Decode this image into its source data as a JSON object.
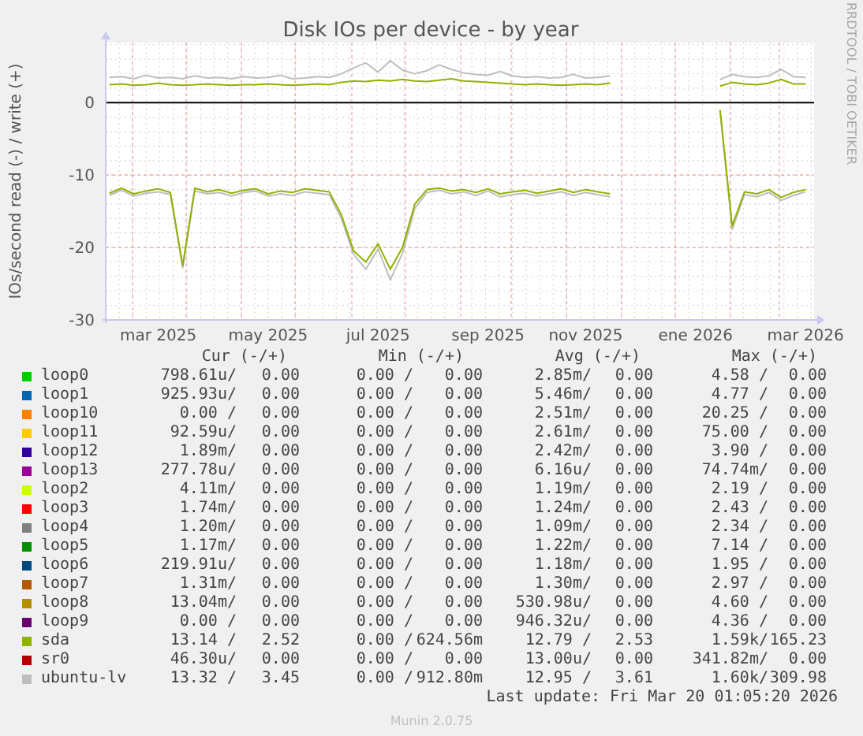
{
  "chart_data": {
    "type": "line",
    "title": "Disk IOs per device - by year",
    "ylabel": "IOs/second read (-) / write (+)",
    "categories": [
      null,
      null,
      null,
      null,
      "mar 2025",
      null,
      null,
      null,
      null,
      null,
      null,
      null,
      null,
      "may 2025",
      null,
      null,
      null,
      null,
      null,
      null,
      null,
      null,
      "jul 2025",
      null,
      null,
      null,
      null,
      null,
      null,
      null,
      null,
      "sep 2025",
      null,
      null,
      null,
      null,
      null,
      null,
      null,
      "nov 2025",
      null,
      null,
      null,
      null,
      null,
      null,
      null,
      null,
      "ene 2026",
      null,
      null,
      null,
      null,
      null,
      null,
      null,
      null,
      "mar 2026"
    ],
    "ylim": [
      -30,
      8.3
    ],
    "grid": true,
    "yticks": [
      0,
      -10,
      -20,
      -30
    ],
    "series": [
      {
        "color": "#bebebe",
        "values": [
          3.5,
          3.6,
          3.3,
          3.8,
          3.4,
          3.5,
          3.3,
          3.7,
          3.4,
          3.5,
          3.3,
          3.6,
          3.4,
          3.5,
          3.8,
          3.3,
          3.4,
          3.6,
          3.5,
          4.0,
          4.8,
          5.5,
          4.2,
          5.8,
          4.5,
          4.0,
          4.4,
          5.2,
          4.6,
          4.1,
          3.9,
          3.8,
          4.3,
          3.7,
          3.5,
          3.6,
          3.4,
          3.5,
          3.9,
          3.4,
          3.5,
          3.7,
          null,
          null,
          null,
          null,
          null,
          null,
          null,
          null,
          3.2,
          3.9,
          3.6,
          3.5,
          3.7,
          4.6,
          3.6,
          3.5
        ]
      },
      {
        "color": "#8fb300",
        "values": [
          2.5,
          2.6,
          2.4,
          2.5,
          2.7,
          2.5,
          2.4,
          2.5,
          2.6,
          2.5,
          2.4,
          2.5,
          2.5,
          2.6,
          2.5,
          2.4,
          2.5,
          2.6,
          2.5,
          2.8,
          3.0,
          2.9,
          3.1,
          3.0,
          3.2,
          3.0,
          2.9,
          3.1,
          3.3,
          3.0,
          2.9,
          2.8,
          2.7,
          2.6,
          2.5,
          2.6,
          2.5,
          2.4,
          2.5,
          2.6,
          2.5,
          2.7,
          null,
          null,
          null,
          null,
          null,
          null,
          null,
          null,
          2.3,
          2.8,
          2.6,
          2.5,
          2.7,
          3.2,
          2.6,
          2.6
        ]
      },
      {
        "color": "#bebebe",
        "values": [
          -12.8,
          -12.1,
          -12.9,
          -12.5,
          -12.3,
          -12.7,
          -22.8,
          -12.2,
          -12.6,
          -12.4,
          -12.9,
          -12.4,
          -12.2,
          -12.9,
          -12.6,
          -12.8,
          -12.3,
          -12.5,
          -12.7,
          -16.0,
          -21.0,
          -23.0,
          -20.2,
          -24.5,
          -20.8,
          -14.6,
          -12.4,
          -12.1,
          -12.6,
          -12.3,
          -12.8,
          -12.2,
          -13.0,
          -12.7,
          -12.5,
          -12.9,
          -12.6,
          -12.3,
          -12.8,
          -12.4,
          -12.7,
          -13.0,
          null,
          null,
          null,
          null,
          null,
          null,
          null,
          null,
          -1.2,
          -17.5,
          -12.7,
          -13.0,
          -12.4,
          -13.5,
          -12.8,
          -12.3
        ]
      },
      {
        "color": "#8fb300",
        "values": [
          -12.5,
          -11.8,
          -12.6,
          -12.2,
          -11.9,
          -12.4,
          -22.5,
          -11.8,
          -12.3,
          -12.0,
          -12.5,
          -12.1,
          -11.9,
          -12.6,
          -12.2,
          -12.4,
          -11.9,
          -12.1,
          -12.3,
          -15.5,
          -20.5,
          -22.0,
          -19.5,
          -23.0,
          -20.0,
          -14.0,
          -12.0,
          -11.8,
          -12.2,
          -12.0,
          -12.4,
          -11.9,
          -12.6,
          -12.3,
          -12.1,
          -12.5,
          -12.2,
          -11.9,
          -12.4,
          -12.0,
          -12.3,
          -12.6,
          null,
          null,
          null,
          null,
          null,
          null,
          null,
          null,
          -1.0,
          -17.0,
          -12.3,
          -12.6,
          -12.0,
          -13.1,
          -12.4,
          -12.0
        ]
      }
    ]
  },
  "side_note": "RRDTOOL / TOBI OETIKER",
  "legend_headers": [
    "Cur (-/+)",
    "Min (-/+)",
    "Avg (-/+)",
    "Max (-/+)"
  ],
  "rows": [
    {
      "name": "loop0",
      "color": "#00cc00",
      "cur": [
        "798.61u/",
        "0.00"
      ],
      "min": [
        "0.00 /",
        "0.00"
      ],
      "avg": [
        "2.85m/",
        "0.00"
      ],
      "max": [
        "4.58 /",
        "0.00"
      ]
    },
    {
      "name": "loop1",
      "color": "#0066b3",
      "cur": [
        "925.93u/",
        "0.00"
      ],
      "min": [
        "0.00 /",
        "0.00"
      ],
      "avg": [
        "5.46m/",
        "0.00"
      ],
      "max": [
        "4.77 /",
        "0.00"
      ]
    },
    {
      "name": "loop10",
      "color": "#ff8000",
      "cur": [
        "0.00 /",
        "0.00"
      ],
      "min": [
        "0.00 /",
        "0.00"
      ],
      "avg": [
        "2.51m/",
        "0.00"
      ],
      "max": [
        "20.25 /",
        "0.00"
      ]
    },
    {
      "name": "loop11",
      "color": "#ffcc00",
      "cur": [
        "92.59u/",
        "0.00"
      ],
      "min": [
        "0.00 /",
        "0.00"
      ],
      "avg": [
        "2.61m/",
        "0.00"
      ],
      "max": [
        "75.00 /",
        "0.00"
      ]
    },
    {
      "name": "loop12",
      "color": "#330099",
      "cur": [
        "1.89m/",
        "0.00"
      ],
      "min": [
        "0.00 /",
        "0.00"
      ],
      "avg": [
        "2.42m/",
        "0.00"
      ],
      "max": [
        "3.90 /",
        "0.00"
      ]
    },
    {
      "name": "loop13",
      "color": "#990099",
      "cur": [
        "277.78u/",
        "0.00"
      ],
      "min": [
        "0.00 /",
        "0.00"
      ],
      "avg": [
        "6.16u/",
        "0.00"
      ],
      "max": [
        "74.74m/",
        "0.00"
      ]
    },
    {
      "name": "loop2",
      "color": "#ccff00",
      "cur": [
        "4.11m/",
        "0.00"
      ],
      "min": [
        "0.00 /",
        "0.00"
      ],
      "avg": [
        "1.19m/",
        "0.00"
      ],
      "max": [
        "2.19 /",
        "0.00"
      ]
    },
    {
      "name": "loop3",
      "color": "#ff0000",
      "cur": [
        "1.74m/",
        "0.00"
      ],
      "min": [
        "0.00 /",
        "0.00"
      ],
      "avg": [
        "1.24m/",
        "0.00"
      ],
      "max": [
        "2.43 /",
        "0.00"
      ]
    },
    {
      "name": "loop4",
      "color": "#808080",
      "cur": [
        "1.20m/",
        "0.00"
      ],
      "min": [
        "0.00 /",
        "0.00"
      ],
      "avg": [
        "1.09m/",
        "0.00"
      ],
      "max": [
        "2.34 /",
        "0.00"
      ]
    },
    {
      "name": "loop5",
      "color": "#008f00",
      "cur": [
        "1.17m/",
        "0.00"
      ],
      "min": [
        "0.00 /",
        "0.00"
      ],
      "avg": [
        "1.22m/",
        "0.00"
      ],
      "max": [
        "7.14 /",
        "0.00"
      ]
    },
    {
      "name": "loop6",
      "color": "#00487d",
      "cur": [
        "219.91u/",
        "0.00"
      ],
      "min": [
        "0.00 /",
        "0.00"
      ],
      "avg": [
        "1.18m/",
        "0.00"
      ],
      "max": [
        "1.95 /",
        "0.00"
      ]
    },
    {
      "name": "loop7",
      "color": "#b35a00",
      "cur": [
        "1.31m/",
        "0.00"
      ],
      "min": [
        "0.00 /",
        "0.00"
      ],
      "avg": [
        "1.30m/",
        "0.00"
      ],
      "max": [
        "2.97 /",
        "0.00"
      ]
    },
    {
      "name": "loop8",
      "color": "#b38f00",
      "cur": [
        "13.04m/",
        "0.00"
      ],
      "min": [
        "0.00 /",
        "0.00"
      ],
      "avg": [
        "530.98u/",
        "0.00"
      ],
      "max": [
        "4.60 /",
        "0.00"
      ]
    },
    {
      "name": "loop9",
      "color": "#6b006b",
      "cur": [
        "0.00 /",
        "0.00"
      ],
      "min": [
        "0.00 /",
        "0.00"
      ],
      "avg": [
        "946.32u/",
        "0.00"
      ],
      "max": [
        "4.36 /",
        "0.00"
      ]
    },
    {
      "name": "sda",
      "color": "#8fb300",
      "cur": [
        "13.14 /",
        "2.52"
      ],
      "min": [
        "0.00 /",
        "624.56m"
      ],
      "avg": [
        "12.79 /",
        "2.53"
      ],
      "max": [
        "1.59k/",
        "165.23"
      ]
    },
    {
      "name": "sr0",
      "color": "#b30000",
      "cur": [
        "46.30u/",
        "0.00"
      ],
      "min": [
        "0.00 /",
        "0.00"
      ],
      "avg": [
        "13.00u/",
        "0.00"
      ],
      "max": [
        "341.82m/",
        "0.00"
      ]
    },
    {
      "name": "ubuntu-lv",
      "color": "#bebebe",
      "cur": [
        "13.32 /",
        "3.45"
      ],
      "min": [
        "0.00 /",
        "912.80m"
      ],
      "avg": [
        "12.95 /",
        "3.61"
      ],
      "max": [
        "1.60k/",
        "309.98"
      ]
    }
  ],
  "last_update": "Last update: Fri Mar 20 01:05:20 2026",
  "footer": "Munin 2.0.75"
}
